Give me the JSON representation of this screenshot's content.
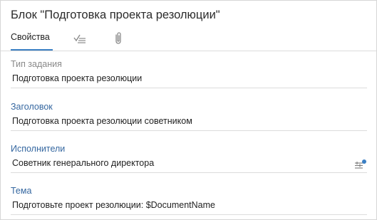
{
  "block": {
    "title": "Блок \"Подготовка проекта резолюции\""
  },
  "tabs": [
    {
      "label": "Свойства",
      "active": true
    },
    {
      "icon": "check-list-icon"
    },
    {
      "icon": "paperclip-icon"
    }
  ],
  "fields": {
    "task_type": {
      "label": "Тип задания",
      "value": "Подготовка проекта резолюции"
    },
    "heading": {
      "label": "Заголовок",
      "value": "Подготовка проекта резолюции советником"
    },
    "performers": {
      "label": "Исполнители",
      "value": "Советник генерального директора",
      "icon": "list-picker-icon"
    },
    "subject": {
      "label": "Тема",
      "value": "Подготовьте проект резолюции: $DocumentName"
    }
  },
  "colors": {
    "accent": "#3a7fc4",
    "label_accent": "#3567a0",
    "label_muted": "#8a8a8a",
    "divider": "#dcdcdc"
  }
}
